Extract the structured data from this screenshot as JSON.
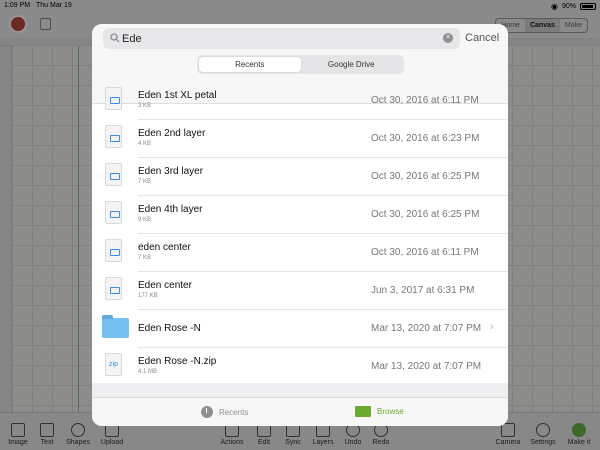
{
  "statusbar": {
    "time": "1:09 PM",
    "date": "Thu Mar 19",
    "battery": "90%"
  },
  "mode_tabs": [
    "Home",
    "Canvas",
    "Make"
  ],
  "toolbar": {
    "left": [
      "Image",
      "Text",
      "Shapes",
      "Upload"
    ],
    "middle": [
      "Actions",
      "Edit",
      "Sync",
      "Layers",
      "Undo",
      "Redo"
    ],
    "right": [
      "Camera",
      "Settings",
      "Make it"
    ]
  },
  "search": {
    "value": "Ede",
    "cancel": "Cancel"
  },
  "segments": {
    "recents": "Recents",
    "google_drive": "Google Drive",
    "active": "Recents"
  },
  "files": [
    {
      "name": "Eden 1st XL petal",
      "size": "3 KB",
      "date": "Oct 30, 2016 at 6:11 PM",
      "kind": "file"
    },
    {
      "name": "Eden 2nd layer",
      "size": "4 KB",
      "date": "Oct 30, 2016 at 6:23 PM",
      "kind": "file"
    },
    {
      "name": "Eden 3rd layer",
      "size": "7 KB",
      "date": "Oct 30, 2016 at 6:25 PM",
      "kind": "file"
    },
    {
      "name": "Eden 4th  layer",
      "size": "9 KB",
      "date": "Oct 30, 2016 at 6:25 PM",
      "kind": "file"
    },
    {
      "name": "eden center",
      "size": "7 KB",
      "date": "Oct 30, 2016 at 6:11 PM",
      "kind": "file"
    },
    {
      "name": "Eden center",
      "size": "177 KB",
      "date": "Jun 3, 2017 at 6:31 PM",
      "kind": "file"
    },
    {
      "name": "Eden Rose -N",
      "size": "",
      "date": "Mar 13, 2020 at 7:07 PM",
      "kind": "folder"
    },
    {
      "name": "Eden Rose -N.zip",
      "size": "4.1 MB",
      "date": "Mar 13, 2020 at 7:07 PM",
      "kind": "zip",
      "icon_text": "zip"
    }
  ],
  "tabbar": {
    "recents": "Recents",
    "browse": "Browse",
    "active": "Browse"
  },
  "colors": {
    "accent_green": "#6aaa2d",
    "folder_blue": "#74c0f2",
    "file_blue": "#3a8ee6"
  }
}
